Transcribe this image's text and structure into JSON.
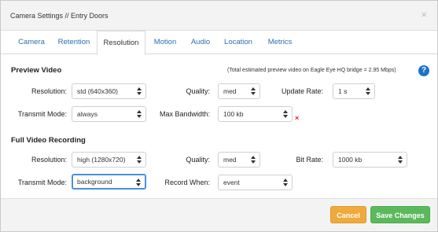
{
  "dialog": {
    "title": "Camera Settings // Entry Doors",
    "close_glyph": "×"
  },
  "tabs": [
    {
      "label": "Camera",
      "active": false
    },
    {
      "label": "Retention",
      "active": false
    },
    {
      "label": "Resolution",
      "active": true
    },
    {
      "label": "Motion",
      "active": false
    },
    {
      "label": "Audio",
      "active": false
    },
    {
      "label": "Location",
      "active": false
    },
    {
      "label": "Metrics",
      "active": false
    }
  ],
  "preview": {
    "title": "Preview Video",
    "note": "(Total estimated preview video on Eagle Eye HQ bridge = 2.95 Mbps)",
    "help_glyph": "?",
    "resolution": {
      "label": "Resolution:",
      "value": "std (640x360)"
    },
    "quality": {
      "label": "Quality:",
      "value": "med"
    },
    "update_rate": {
      "label": "Update Rate:",
      "value": "1 s"
    },
    "transmit_mode": {
      "label": "Transmit Mode:",
      "value": "always"
    },
    "max_bandwidth": {
      "label": "Max Bandwidth:",
      "value": "100 kb"
    },
    "error_glyph": "×"
  },
  "full": {
    "title": "Full Video Recording",
    "resolution": {
      "label": "Resolution:",
      "value": "high (1280x720)"
    },
    "quality": {
      "label": "Quality:",
      "value": "med"
    },
    "bit_rate": {
      "label": "Bit Rate:",
      "value": "1000 kb"
    },
    "transmit_mode": {
      "label": "Transmit Mode:",
      "value": "background"
    },
    "record_when": {
      "label": "Record When:",
      "value": "event"
    }
  },
  "footer": {
    "cancel_label": "Cancel",
    "save_label": "Save Changes"
  },
  "colors": {
    "tab_link": "#2a6fb0",
    "help_icon": "#1a73c8",
    "cancel_button": "#f0a93b",
    "save_button": "#5cb85c",
    "error": "#e02020",
    "focus_border": "#4a90d9"
  }
}
